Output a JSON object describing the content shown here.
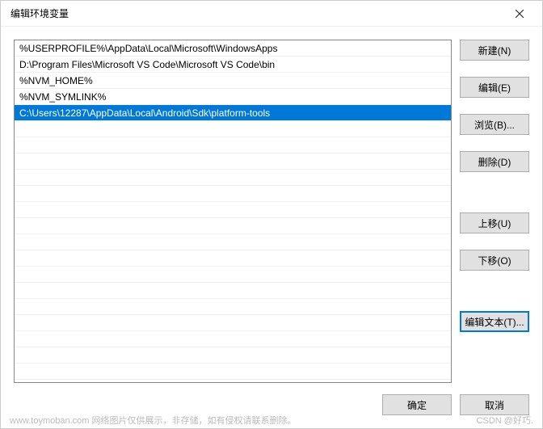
{
  "title": "编辑环境变量",
  "entries": [
    {
      "text": "%USERPROFILE%\\AppData\\Local\\Microsoft\\WindowsApps",
      "selected": false
    },
    {
      "text": "D:\\Program Files\\Microsoft VS Code\\Microsoft VS Code\\bin",
      "selected": false
    },
    {
      "text": "%NVM_HOME%",
      "selected": false
    },
    {
      "text": "%NVM_SYMLINK%",
      "selected": false
    },
    {
      "text": "C:\\Users\\12287\\AppData\\Local\\Android\\Sdk\\platform-tools",
      "selected": true
    }
  ],
  "buttons": {
    "new": "新建(N)",
    "edit": "编辑(E)",
    "browse": "浏览(B)...",
    "delete": "删除(D)",
    "moveup": "上移(U)",
    "movedown": "下移(O)",
    "edittext": "编辑文本(T)...",
    "ok": "确定",
    "cancel": "取消"
  },
  "watermark_left": "www.toymoban.com 网络图片仅供展示，非存储，如有侵权请联系删除。",
  "watermark_right": "CSDN @好巧."
}
